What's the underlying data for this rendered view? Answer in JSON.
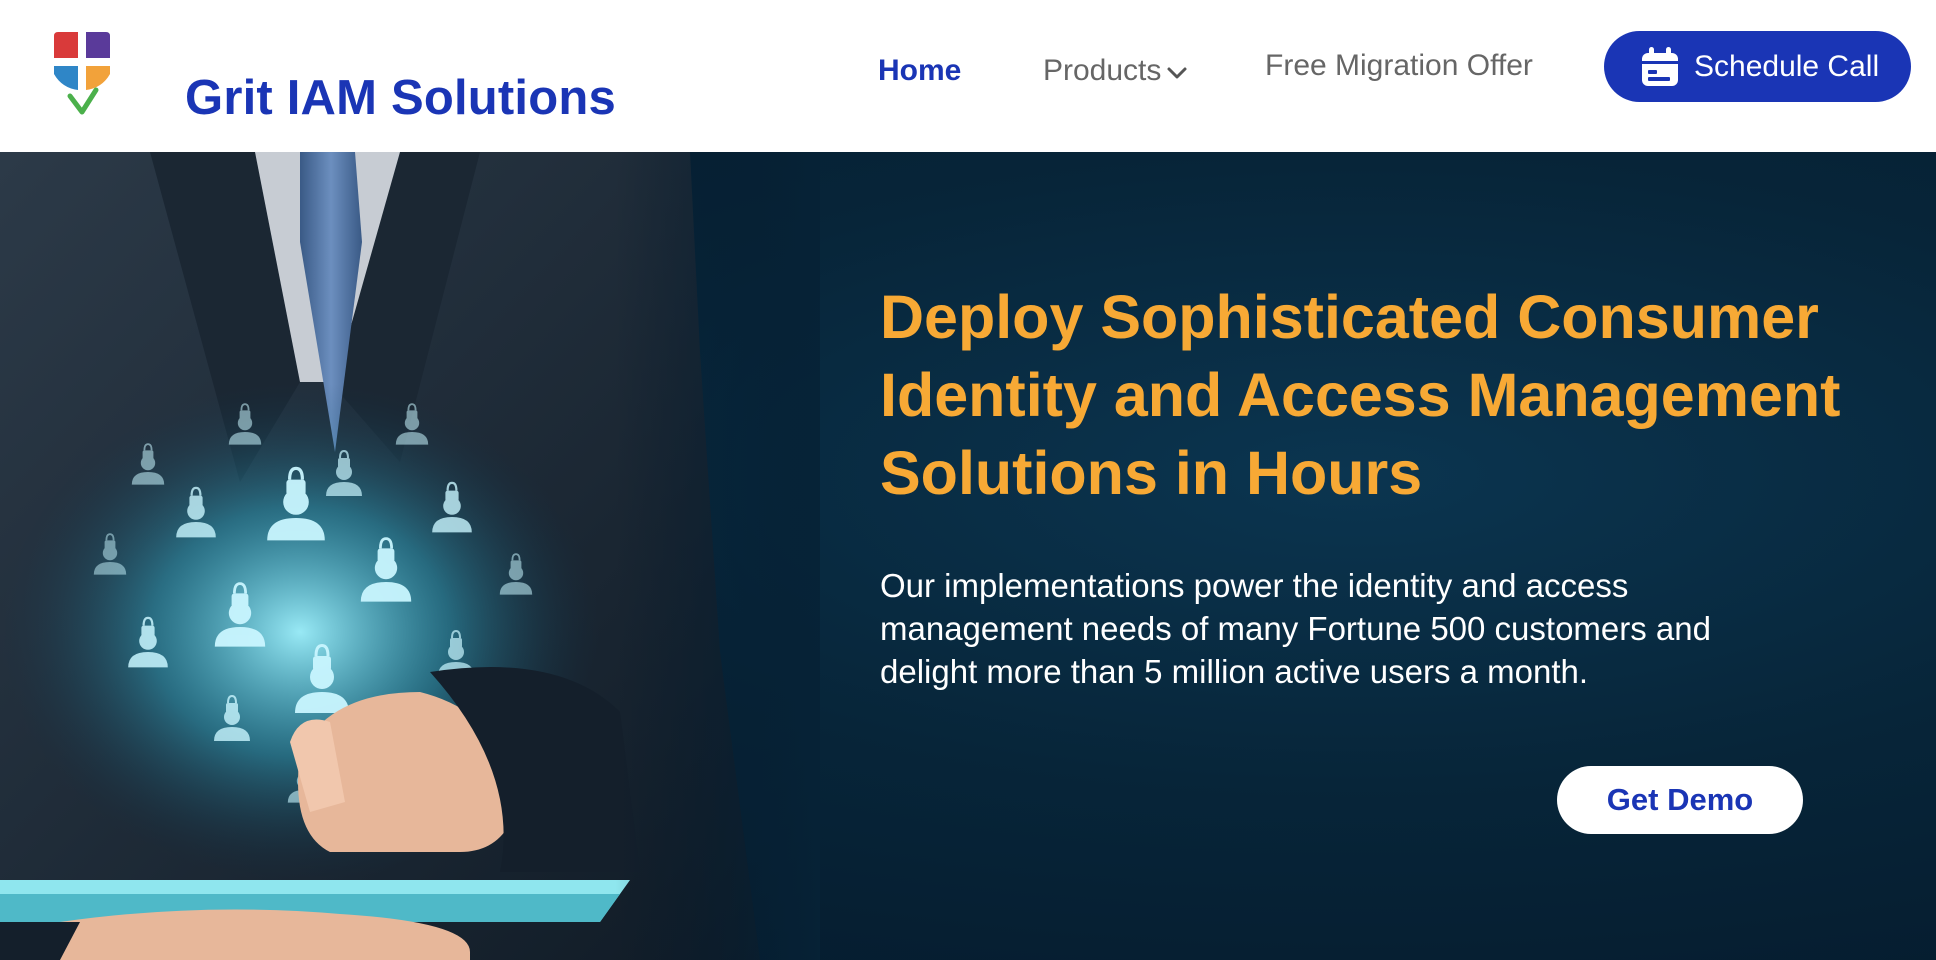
{
  "brand": {
    "name": "Grit IAM Solutions",
    "primary_color": "#1a35b5",
    "accent_color": "#f7a935",
    "logo_icon": "grit-cross-shield-logo"
  },
  "nav": {
    "items": [
      {
        "label": "Home",
        "active": true
      },
      {
        "label": "Products",
        "icon": "chevron-down-icon"
      },
      {
        "label": "Free Migration Offer"
      }
    ],
    "cta": {
      "label": "Schedule Call",
      "icon": "calendar-icon"
    }
  },
  "hero": {
    "title_lines": [
      "Deploy Sophisticated Consumer",
      "Identity and Access Management",
      "Solutions in Hours"
    ],
    "description_lines": [
      "Our implementations power the identity and access",
      "management needs of many Fortune 500 customers and",
      "delight more than 5 million active users a month."
    ],
    "cta_label": "Get Demo",
    "image": "businessman-holding-tablet-with-secured-user-icons"
  }
}
